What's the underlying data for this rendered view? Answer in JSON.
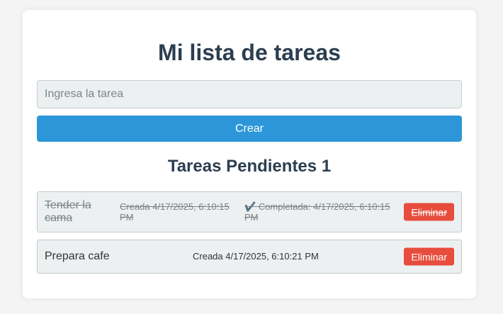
{
  "app": {
    "title": "Mi lista de tareas"
  },
  "form": {
    "input_placeholder": "Ingresa la tarea",
    "input_value": "",
    "create_label": "Crear"
  },
  "pending": {
    "label": "Tareas Pendientes",
    "count": "1"
  },
  "tasks": [
    {
      "name": "Tender la cama",
      "created": "Creada 4/17/2025, 6:10:15 PM",
      "completed_prefix": "✔️",
      "completed": "Completada: 4/17/2025, 6:10:15 PM",
      "done": true,
      "delete_label": "Eliminar"
    },
    {
      "name": "Prepara cafe",
      "created": "Creada 4/17/2025, 6:10:21 PM",
      "done": false,
      "delete_label": "Eliminar"
    }
  ],
  "colors": {
    "title": "#2c3e50",
    "create_button": "#2d96d8",
    "delete_button": "#e74c3c",
    "task_background": "#ecf0f1"
  }
}
